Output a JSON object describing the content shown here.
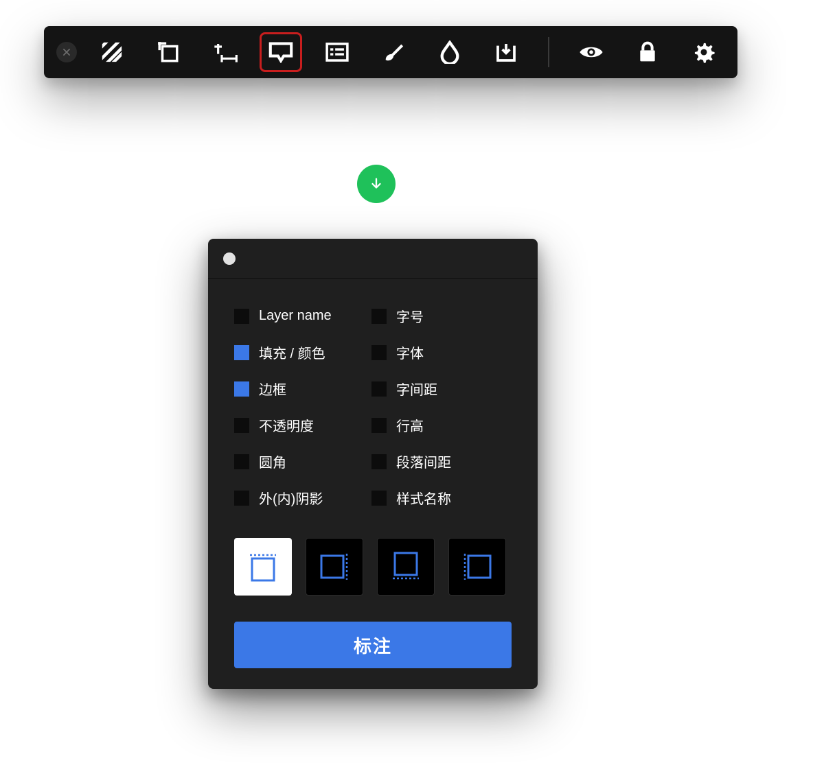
{
  "toolbar": {
    "icons": [
      "hatch-icon",
      "artboard-icon",
      "measure-icon",
      "annotate-icon",
      "list-icon",
      "brush-icon",
      "drop-icon",
      "download-icon",
      "eye-icon",
      "lock-icon",
      "gear-icon"
    ],
    "selected_index": 3
  },
  "panel": {
    "options_left": [
      {
        "label": "Layer name",
        "checked": false
      },
      {
        "label": "填充 / 颜色",
        "checked": true
      },
      {
        "label": "边框",
        "checked": true
      },
      {
        "label": "不透明度",
        "checked": false
      },
      {
        "label": "圆角",
        "checked": false
      },
      {
        "label": "外(内)阴影",
        "checked": false
      }
    ],
    "options_right": [
      {
        "label": "字号",
        "checked": false
      },
      {
        "label": "字体",
        "checked": false
      },
      {
        "label": "字间距",
        "checked": false
      },
      {
        "label": "行高",
        "checked": false
      },
      {
        "label": "段落间距",
        "checked": false
      },
      {
        "label": "样式名称",
        "checked": false
      }
    ],
    "position_modes": [
      {
        "name": "top",
        "selected": true
      },
      {
        "name": "right",
        "selected": false
      },
      {
        "name": "bottom",
        "selected": false
      },
      {
        "name": "left",
        "selected": false
      }
    ],
    "annotate_label": "标注"
  },
  "colors": {
    "accent_blue": "#3b78e7",
    "accent_green": "#1fc15a",
    "selected_red": "#c81e1e"
  }
}
